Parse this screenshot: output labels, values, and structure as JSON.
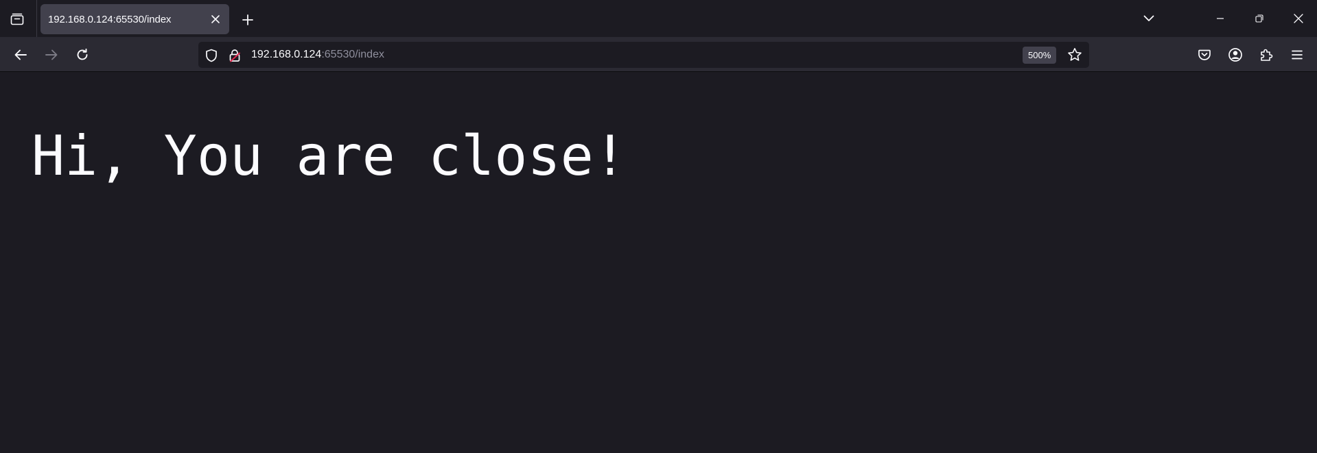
{
  "browser": {
    "tab": {
      "title": "192.168.0.124:65530/index"
    },
    "urlbar": {
      "host": "192.168.0.124",
      "rest": ":65530/index",
      "zoom": "500%"
    },
    "icons": {
      "tab_list": "tab-list-icon",
      "tab_close": "close-icon",
      "new_tab": "plus-icon",
      "list_all_tabs": "chevron-down-icon",
      "minimize": "minimize-icon",
      "restore": "restore-icon",
      "window_close": "close-icon",
      "back": "arrow-left-icon",
      "forward": "arrow-right-icon",
      "reload": "reload-icon",
      "tracking_protection": "shield-icon",
      "insecure": "lock-warning-icon",
      "bookmark": "star-icon",
      "pocket": "pocket-icon",
      "account": "account-icon",
      "extensions": "puzzle-icon",
      "menu": "hamburger-icon"
    },
    "colors": {
      "background": "#1c1b22",
      "toolbar": "#2b2a33",
      "tab_selected": "#42414d",
      "text": "#fbfbfe",
      "muted_text": "#8f8f9d",
      "insecure_accent": "#e22850"
    }
  },
  "page": {
    "heading": "Hi, You are close!"
  }
}
